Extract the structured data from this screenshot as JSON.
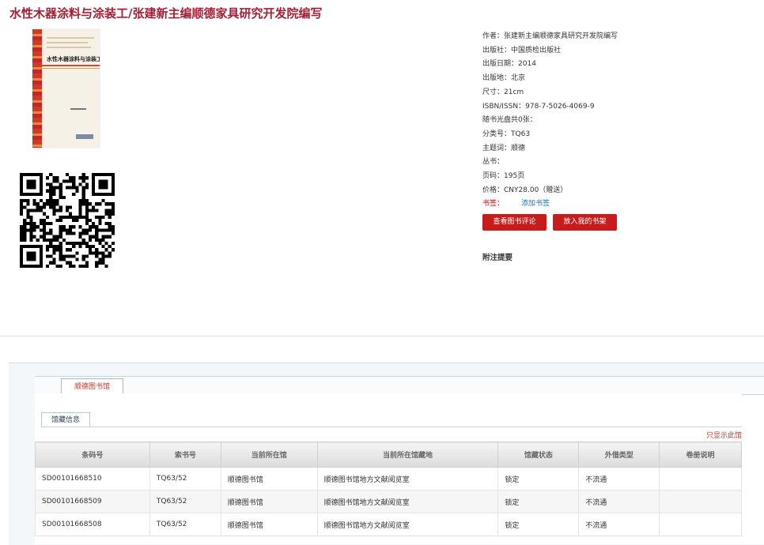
{
  "page_title": "水性木器涂料与涂装工/张建新主编顺德家具研究开发院编写",
  "cover": {
    "title_text": "水性木器涂料与涂装工"
  },
  "meta": [
    {
      "label": "作者：",
      "value": "张建新主编顺德家具研究开发院编写"
    },
    {
      "label": "出版社：",
      "value": "中国质检出版社"
    },
    {
      "label": "出版日期：",
      "value": "2014"
    },
    {
      "label": "出版地：",
      "value": "北京"
    },
    {
      "label": "尺寸：",
      "value": "21cm"
    },
    {
      "label": "ISBN/ISSN：",
      "value": "978-7-5026-4069-9"
    },
    {
      "label": "随书光盘共0张：",
      "value": ""
    },
    {
      "label": "分类号：",
      "value": "TQ63"
    },
    {
      "label": "主题词：",
      "value": "顺德"
    },
    {
      "label": "丛书：",
      "value": ""
    },
    {
      "label": "页码：",
      "value": "195页"
    },
    {
      "label": "价格：",
      "value": "CNY28.00（赠送）"
    }
  ],
  "tags": {
    "label": "书签：",
    "link": "添加书签"
  },
  "buttons": {
    "review": "查看图书评论",
    "shelf": "放入我的书架"
  },
  "notes_heading": "附注提要",
  "library_tab": "顺德图书馆",
  "holdings_tab": "馆藏信息",
  "only_this_library": "只显示此馆",
  "table": {
    "headers": [
      "条码号",
      "索书号",
      "当前所在馆",
      "当前所在馆藏地",
      "馆藏状态",
      "外借类型",
      "卷册说明"
    ],
    "rows": [
      [
        "SD00101668510",
        "TQ63/52",
        "顺德图书馆",
        "顺德图书馆地方文献阅览室",
        "锁定",
        "不流通",
        ""
      ],
      [
        "SD00101668509",
        "TQ63/52",
        "顺德图书馆",
        "顺德图书馆地方文献阅览室",
        "锁定",
        "不流通",
        ""
      ],
      [
        "SD00101668508",
        "TQ63/52",
        "顺德图书馆",
        "顺德图书馆地方文献阅览室",
        "锁定",
        "不流通",
        ""
      ]
    ]
  }
}
